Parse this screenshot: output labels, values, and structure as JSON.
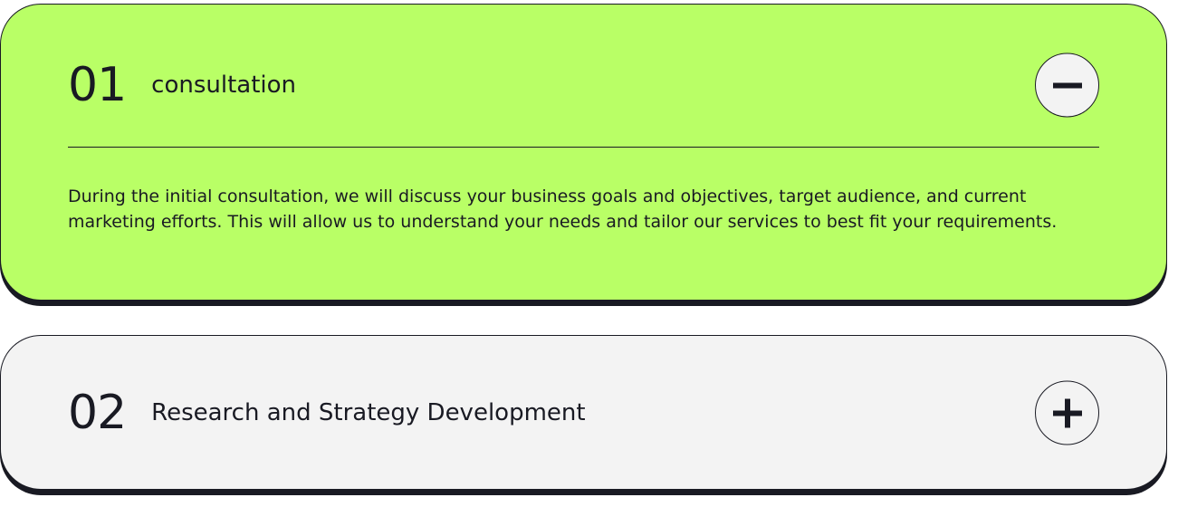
{
  "colors": {
    "accent": "#b9ff66",
    "muted": "#f3f3f3",
    "dark": "#191a23"
  },
  "items": [
    {
      "number": "01",
      "title": "consultation",
      "expanded": true,
      "toggle_icon": "minus-icon",
      "description": "During the initial consultation, we will discuss your business goals and objectives, target audience, and current marketing efforts. This will allow us to understand your needs and tailor our services to best fit your requirements."
    },
    {
      "number": "02",
      "title": "Research and Strategy Development",
      "expanded": false,
      "toggle_icon": "plus-icon"
    }
  ]
}
